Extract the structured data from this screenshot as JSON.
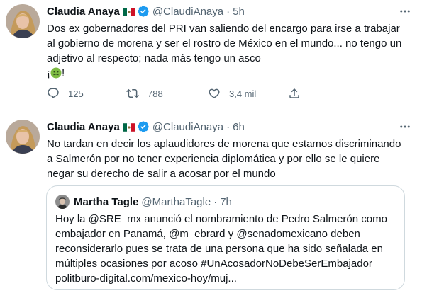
{
  "colors": {
    "text": "#0f1419",
    "secondary": "#536471",
    "verified": "#1d9bf0",
    "border": "#cfd9de"
  },
  "tweets": [
    {
      "author_name": "Claudia Anaya",
      "flag": "mexico-flag",
      "handle": "@ClaudiAnaya",
      "dot": "·",
      "time": "5h",
      "lines": [
        "Dos ex gobernadores del PRI van saliendo del encargo para irse a  trabajar",
        "al gobierno de morena y ser el rostro de México en el mundo... no tengo un",
        "adjetivo al respecto; nada más tengo un asco"
      ],
      "emoji_open": "¡",
      "emoji_close": "!",
      "emoji_icon": "nauseated-face-emoji",
      "replies": "125",
      "retweets": "788",
      "likes": "3,4 mil"
    },
    {
      "author_name": "Claudia Anaya",
      "flag": "mexico-flag",
      "handle": "@ClaudiAnaya",
      "dot": "·",
      "time": "6h",
      "lines": [
        "No tardan en decir los aplaudidores de morena que estamos discriminando",
        "a Salmerón por no tener experiencia diplomática y por ello se le quiere",
        "negar su derecho de salir a acosar por el mundo"
      ],
      "quote": {
        "author_name": "Martha Tagle",
        "handle": "@MarthaTagle",
        "dot": "·",
        "time": "7h",
        "lines": [
          "Hoy la @SRE_mx anunció el nombramiento de Pedro Salmerón como",
          "embajador en Panamá, @m_ebrard y @senadomexicano deben",
          "reconsiderarlo pues se trata de una persona que ha sido señalada en",
          "múltiples ocasiones por acoso #UnAcosadorNoDebeSerEmbajador",
          "politburo-digital.com/mexico-hoy/muj..."
        ]
      }
    }
  ]
}
